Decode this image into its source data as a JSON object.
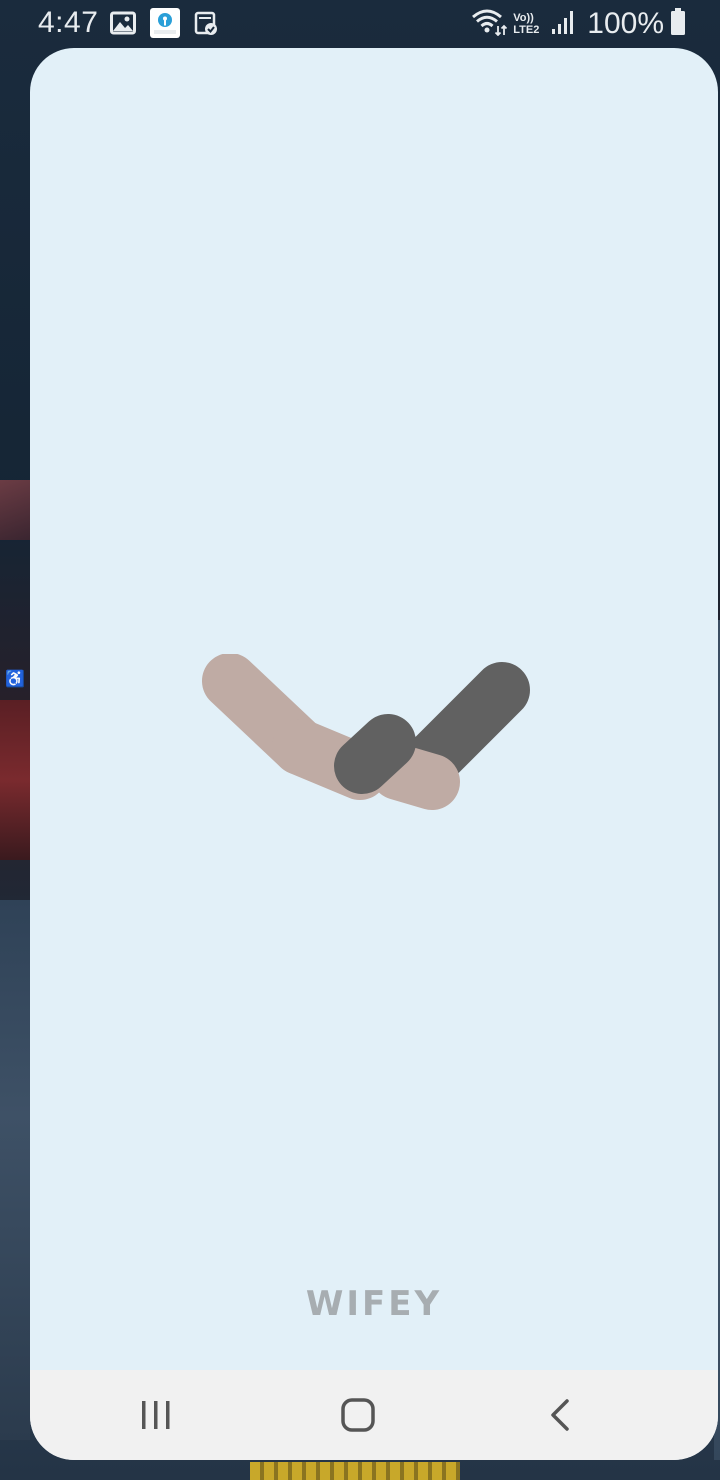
{
  "status_bar": {
    "time": "4:47",
    "network_label": "Vo)) LTE2",
    "battery": "100%",
    "icons": [
      "image-icon",
      "sbi-card-icon",
      "calendar-check-icon",
      "wifi-icon",
      "signal-icon",
      "battery-icon"
    ]
  },
  "app": {
    "brand_name": "WIFEY",
    "background_color": "#e2f0f8",
    "logo_colors": {
      "light_stroke": "#bfaba4",
      "dark_stroke": "#616161"
    }
  },
  "nav_bar": {
    "buttons": [
      "recents-button",
      "home-button",
      "back-button"
    ]
  }
}
